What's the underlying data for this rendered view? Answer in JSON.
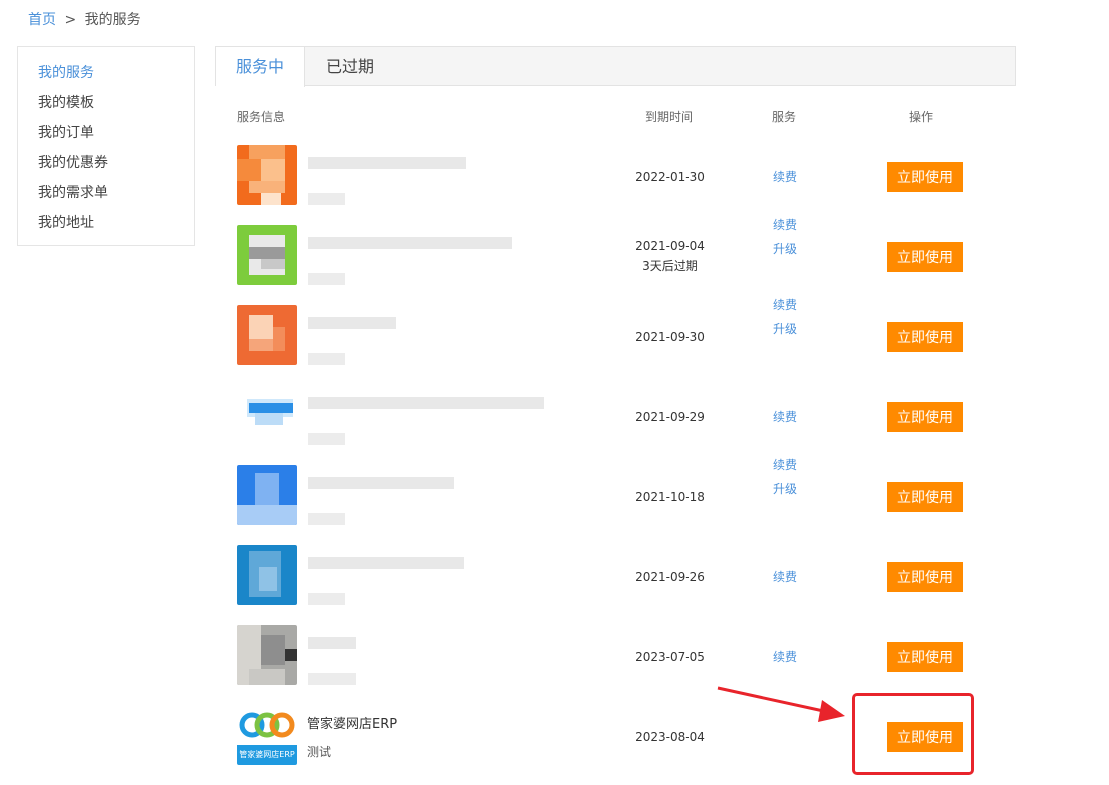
{
  "breadcrumb": {
    "home": "首页",
    "separator": ">",
    "current": "我的服务"
  },
  "sidebar": {
    "items": [
      {
        "label": "我的服务",
        "active": true
      },
      {
        "label": "我的模板",
        "active": false
      },
      {
        "label": "我的订单",
        "active": false
      },
      {
        "label": "我的优惠券",
        "active": false
      },
      {
        "label": "我的需求单",
        "active": false
      },
      {
        "label": "我的地址",
        "active": false
      }
    ]
  },
  "tabs": [
    {
      "label": "服务中",
      "active": true
    },
    {
      "label": "已过期",
      "active": false
    }
  ],
  "table": {
    "headers": {
      "info": "服务信息",
      "expire": "到期时间",
      "service": "服务",
      "action": "操作"
    },
    "rows": [
      {
        "expire": "2022-01-30",
        "note": "",
        "links": [
          "续费"
        ],
        "action": "立即使用"
      },
      {
        "expire": "2021-09-04",
        "note": "3天后过期",
        "links": [
          "续费",
          "升级"
        ],
        "action": "立即使用"
      },
      {
        "expire": "2021-09-30",
        "note": "",
        "links": [
          "续费",
          "升级"
        ],
        "action": "立即使用"
      },
      {
        "expire": "2021-09-29",
        "note": "",
        "links": [
          "续费"
        ],
        "action": "立即使用"
      },
      {
        "expire": "2021-10-18",
        "note": "",
        "links": [
          "续费",
          "升级"
        ],
        "action": "立即使用"
      },
      {
        "expire": "2021-09-26",
        "note": "",
        "links": [
          "续费"
        ],
        "action": "立即使用"
      },
      {
        "expire": "2023-07-05",
        "note": "",
        "links": [
          "续费"
        ],
        "action": "立即使用"
      },
      {
        "name": "管家婆网店ERP",
        "sub": "测试",
        "logo_text": "管家婆网店ERP",
        "expire": "2023-08-04",
        "note": "",
        "links": [],
        "action": "立即使用"
      }
    ]
  },
  "colors": {
    "accent": "#4a90d9",
    "button": "#ff8a00",
    "annotation": "#e8242b"
  }
}
